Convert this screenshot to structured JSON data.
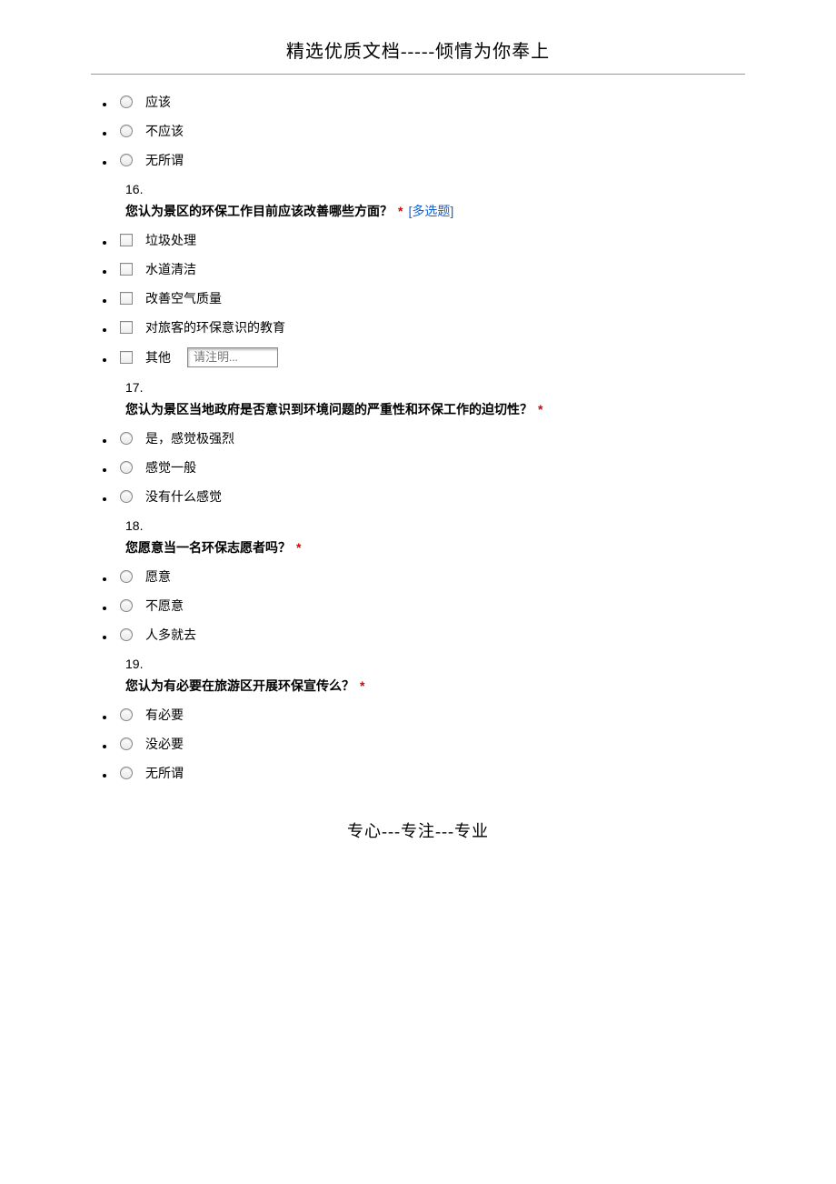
{
  "header": "精选优质文档-----倾情为你奉上",
  "footer": "专心---专注---专业",
  "q15_options": [
    "应该",
    "不应该",
    "无所谓"
  ],
  "q16": {
    "number": "16.",
    "text": "您认为景区的环保工作目前应该改善哪些方面？",
    "required": "*",
    "multi_tag": "[多选题]",
    "options": [
      "垃圾处理",
      "水道清洁",
      "改善空气质量",
      "对旅客的环保意识的教育"
    ],
    "other_label": "其他",
    "other_placeholder": "请注明..."
  },
  "q17": {
    "number": "17.",
    "text": "您认为景区当地政府是否意识到环境问题的严重性和环保工作的迫切性？",
    "required": "*",
    "options": [
      "是，感觉极强烈",
      "感觉一般",
      "没有什么感觉"
    ]
  },
  "q18": {
    "number": "18.",
    "text": "您愿意当一名环保志愿者吗？",
    "required": "*",
    "options": [
      "愿意",
      "不愿意",
      "人多就去"
    ]
  },
  "q19": {
    "number": "19.",
    "text": "您认为有必要在旅游区开展环保宣传么？",
    "required": "*",
    "options": [
      "有必要",
      "没必要",
      "无所谓"
    ]
  }
}
